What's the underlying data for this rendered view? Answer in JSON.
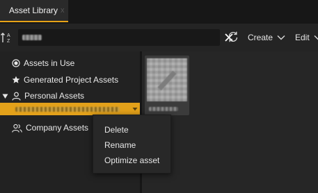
{
  "tab": {
    "title": "Asset Library",
    "close_glyph": "x"
  },
  "toolbar": {
    "search_value": "",
    "create_label": "Create",
    "edit_label": "Edit"
  },
  "tree": {
    "items": [
      {
        "label": "Assets in Use",
        "icon": "radio-target-icon"
      },
      {
        "label": "Generated Project Assets",
        "icon": "star-icon"
      },
      {
        "label": "Personal Assets",
        "icon": "user-icon"
      },
      {
        "label": "Company Assets",
        "icon": "users-icon"
      }
    ]
  },
  "context_menu": {
    "items": [
      "Delete",
      "Rename",
      "Optimize asset"
    ]
  },
  "colors": {
    "accent": "#e3a11a",
    "background": "#202020",
    "panel": "#262626"
  }
}
